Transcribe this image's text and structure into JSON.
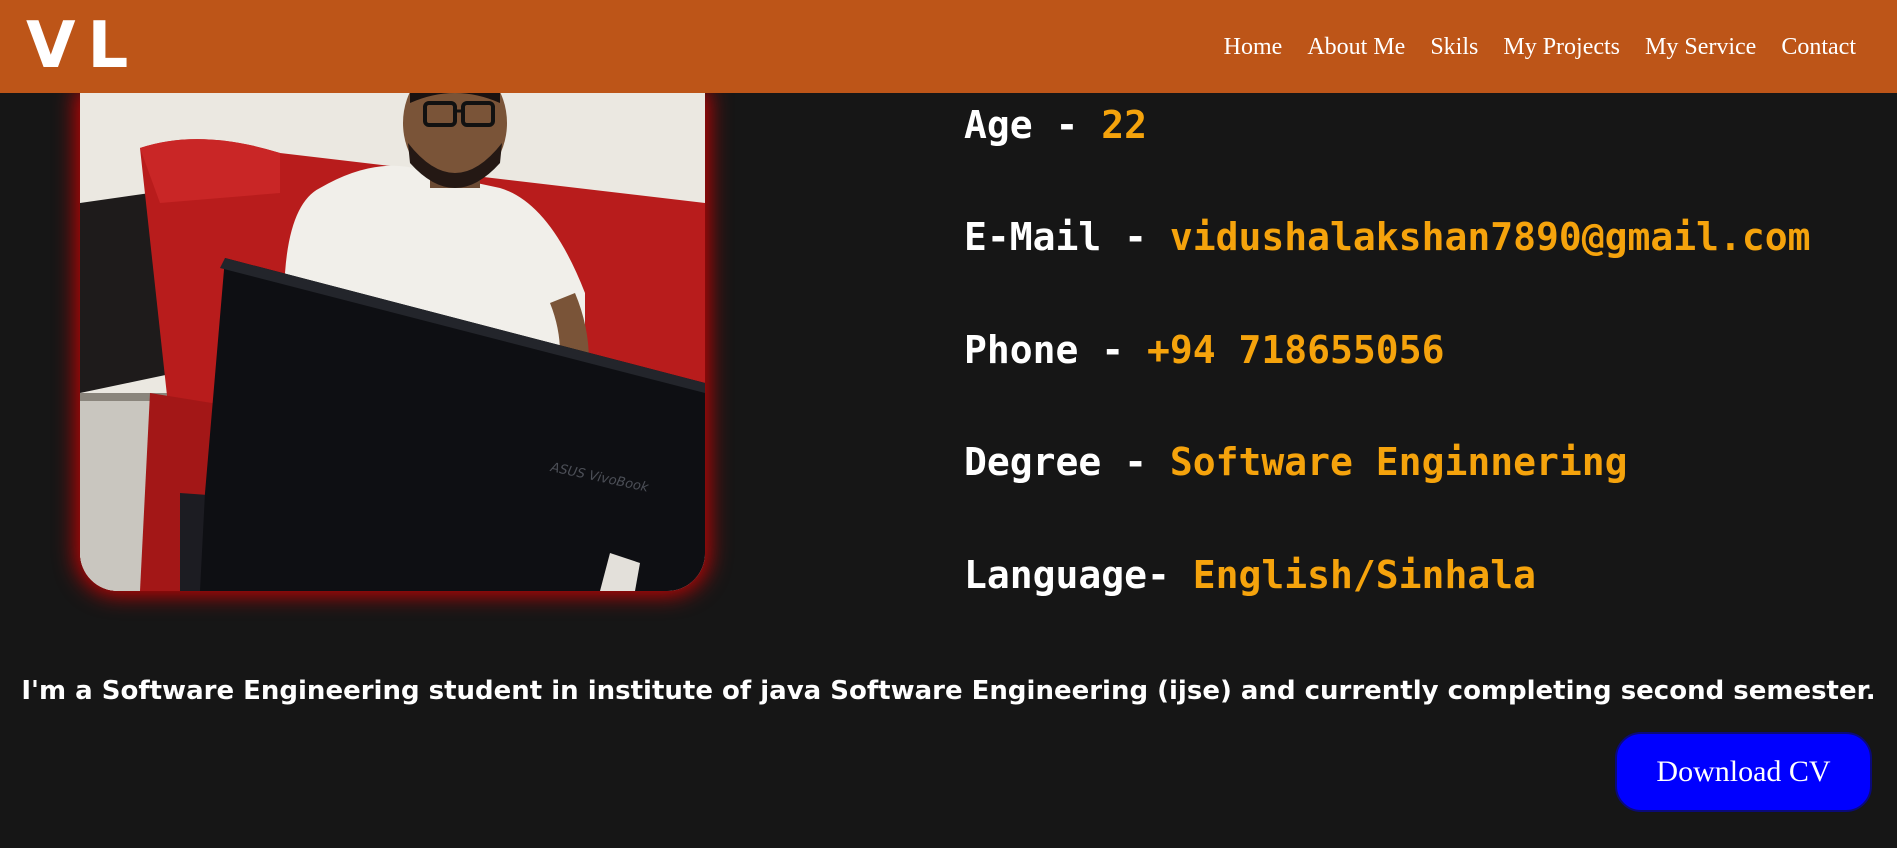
{
  "header": {
    "logo": "VL",
    "nav": [
      {
        "label": "Home"
      },
      {
        "label": "About Me"
      },
      {
        "label": "Skils"
      },
      {
        "label": "My Projects"
      },
      {
        "label": "My Service"
      },
      {
        "label": "Contact"
      }
    ]
  },
  "profile": {
    "photo_icon": "profile-photo",
    "laptop_brand": "ASUS VivoBook"
  },
  "info": [
    {
      "label": "Age - ",
      "value": "22"
    },
    {
      "label": "E-Mail - ",
      "value": "vidushalakshan7890@gmail.com"
    },
    {
      "label": "Phone - ",
      "value": "+94 718655056"
    },
    {
      "label": "Degree - ",
      "value": "Software Enginnering"
    },
    {
      "label": "Language- ",
      "value": "English/Sinhala"
    }
  ],
  "bio": "I'm a Software Engineering student in institute of java Software Engineering (ijse) and currently completing second semester.",
  "download_button": "Download CV",
  "colors": {
    "header_bg": "#bd5518",
    "page_bg": "#161616",
    "accent": "#f5a30c",
    "button_bg": "#0000ff",
    "photo_glow": "#e60000"
  }
}
